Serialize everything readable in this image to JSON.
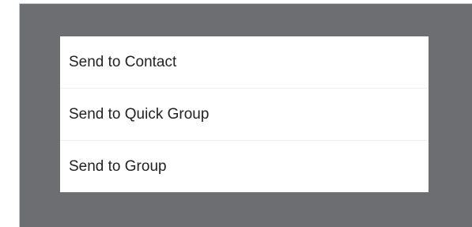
{
  "menu": {
    "items": [
      {
        "label": "Send to Contact"
      },
      {
        "label": "Send to Quick Group"
      },
      {
        "label": "Send to Group"
      }
    ]
  },
  "colors": {
    "overlay": "#6d6e71",
    "menu_background": "#ffffff",
    "text": "#222222"
  }
}
